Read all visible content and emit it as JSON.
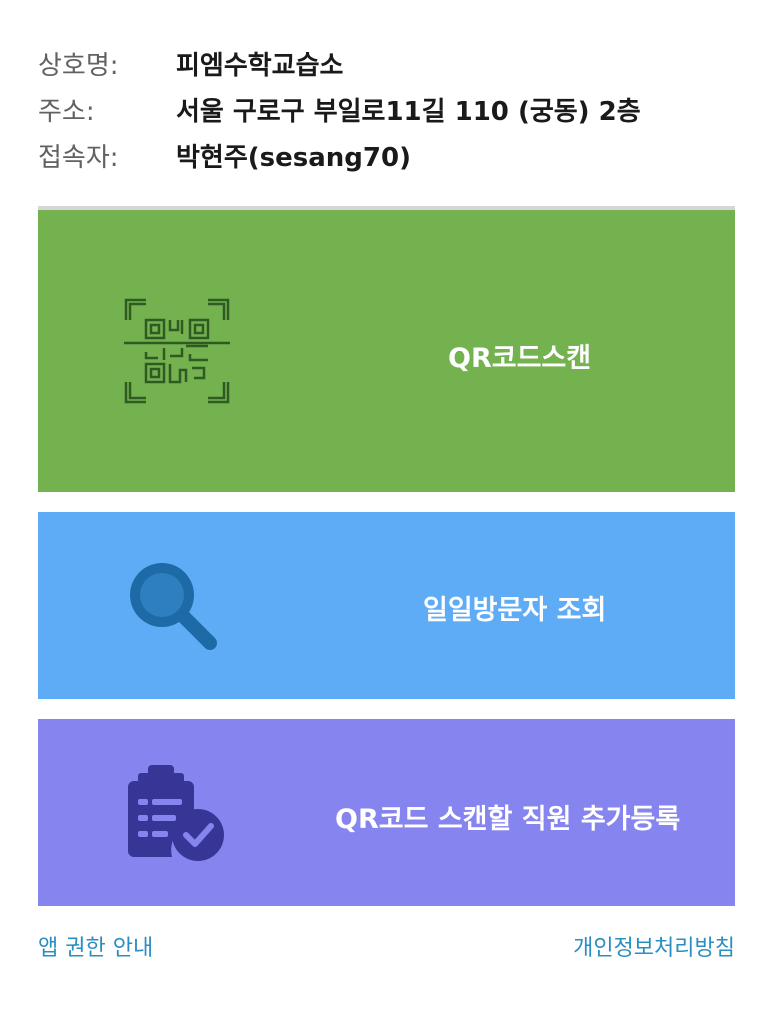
{
  "store_info": {
    "name_label": "상호명:",
    "name_value": "피엠수학교습소",
    "address_label": "주소:",
    "address_value": "서울 구로구 부일로11길 110 (궁동) 2층",
    "user_label": "접속자:",
    "user_value": "박현주(sesang70)"
  },
  "actions": {
    "qr_scan": {
      "label": "QR코드스캔",
      "icon": "qr-scan-icon",
      "color": "#74b250"
    },
    "daily_visitors": {
      "label": "일일방문자 조회",
      "icon": "magnifier-icon",
      "color": "#5eacf5"
    },
    "add_staff": {
      "label": "QR코드 스캔할 직원 추가등록",
      "icon": "clipboard-check-icon",
      "color": "#8684ee"
    }
  },
  "footer": {
    "permissions_link": "앱 권한 안내",
    "privacy_link": "개인정보처리방침"
  }
}
